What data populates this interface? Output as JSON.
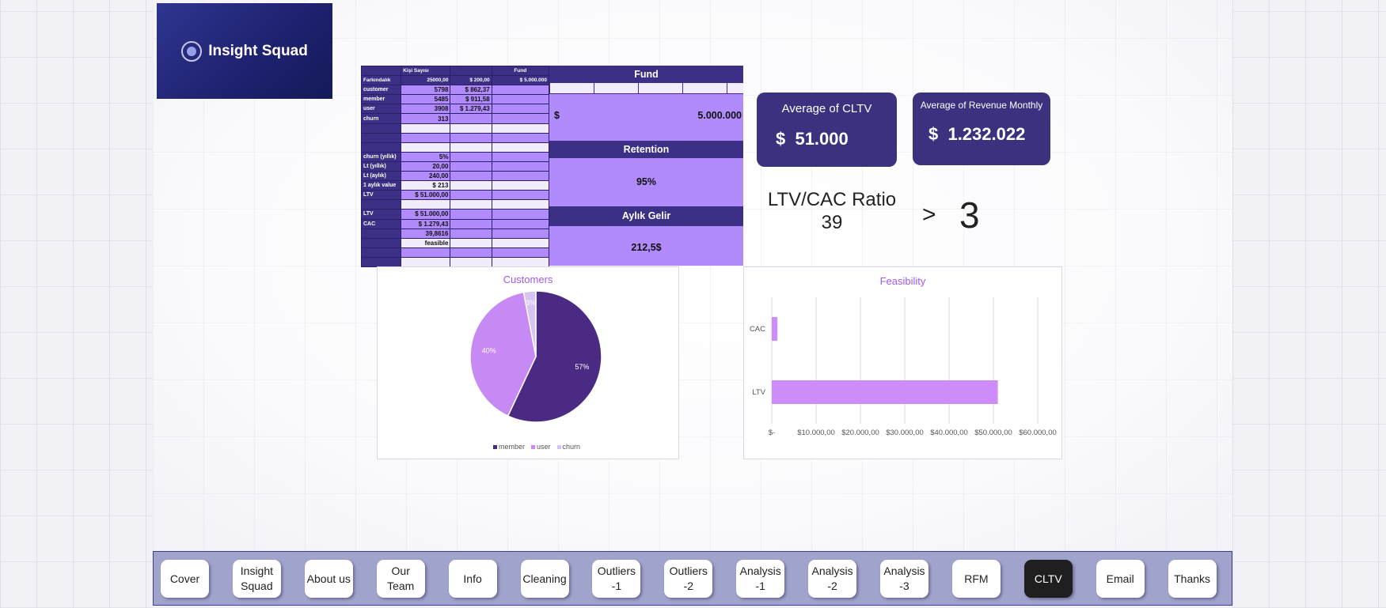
{
  "logo": {
    "text": "Insight Squad"
  },
  "sheet": {
    "header_row": [
      "",
      "Kişi Sayısı",
      "",
      "Fund"
    ],
    "row_farkindalik": [
      "Farkındalık",
      "25000,00",
      "$ 200,00",
      "$ 5.000.000"
    ],
    "rows": [
      {
        "label": "customer",
        "num": "5798",
        "v2": "$ 862,37",
        "v3": ""
      },
      {
        "label": "member",
        "num": "5485",
        "v2": "$ 911,58",
        "v3": ""
      },
      {
        "label": "user",
        "num": "3908",
        "v2": "$ 1.279,43",
        "v3": ""
      },
      {
        "label": "churn",
        "num": "313",
        "v2": "",
        "v3": ""
      },
      {
        "label": "",
        "num": "",
        "v2": "",
        "v3": ""
      },
      {
        "label": "",
        "num": "",
        "v2": "",
        "v3": ""
      },
      {
        "label": "",
        "num": "",
        "v2": "",
        "v3": ""
      },
      {
        "label": "churn (yıllık)",
        "num": "5%",
        "v2": "",
        "v3": ""
      },
      {
        "label": "Lt (yıllık)",
        "num": "20,00",
        "v2": "",
        "v3": ""
      },
      {
        "label": "Lt (aylık)",
        "num": "240,00",
        "v2": "",
        "v3": ""
      },
      {
        "label": "1 aylık value",
        "num": "$ 213",
        "v2": "",
        "v3": ""
      },
      {
        "label": "LTV",
        "num": "$ 51.000,00",
        "v2": "",
        "v3": ""
      },
      {
        "label": "",
        "num": "",
        "v2": "",
        "v3": ""
      },
      {
        "label": "LTV",
        "num": "$ 51.000,00",
        "v2": "",
        "v3": ""
      },
      {
        "label": "CAC",
        "num": "$ 1.279,43",
        "v2": "",
        "v3": ""
      },
      {
        "label": "",
        "num": "39,8616",
        "v2": "",
        "v3": ""
      },
      {
        "label": "",
        "num": "feasible",
        "v2": "",
        "v3": ""
      },
      {
        "label": "",
        "num": "",
        "v2": "",
        "v3": ""
      },
      {
        "label": "",
        "num": "",
        "v2": "",
        "v3": ""
      }
    ],
    "fund_title": "Fund",
    "fund_currency": "$",
    "fund_value": "5.000.000",
    "retention_title": "Retention",
    "retention_value": "95%",
    "income_title": "Aylık Gelir",
    "income_value": "212,5$"
  },
  "kpi": {
    "cltv_label": "Average of CLTV",
    "cltv_value": "$  51.000",
    "revenue_label": "Average of Revenue Monthly",
    "revenue_value": "$  1.232.022"
  },
  "ratio": {
    "label": "LTV/CAC Ratio",
    "value": "39",
    "operator": ">",
    "threshold": "3"
  },
  "colors": {
    "member": "#4a2a83",
    "user": "#c78af5",
    "churn": "#d6c4f2",
    "bar": "#cd8cf7",
    "navy": "#3b327f"
  },
  "chart_data": [
    {
      "type": "pie",
      "title": "Customers",
      "categories": [
        "member",
        "user",
        "churn"
      ],
      "values": [
        57,
        40,
        3
      ],
      "labels": [
        "57%",
        "40%",
        "3%"
      ],
      "legend": "bottom"
    },
    {
      "type": "bar",
      "orientation": "horizontal",
      "title": "Feasibility",
      "categories": [
        "LTV",
        "CAC"
      ],
      "values": [
        51000,
        1279.43
      ],
      "xlim": [
        0,
        60000
      ],
      "xticks": [
        "$-",
        "$10.000,00",
        "$20.000,00",
        "$30.000,00",
        "$40.000,00",
        "$50.000,00",
        "$60.000,00"
      ],
      "grid": true
    }
  ],
  "nav": {
    "items": [
      {
        "label": "Cover"
      },
      {
        "label": "Insight Squad"
      },
      {
        "label": "About us"
      },
      {
        "label": "Our Team"
      },
      {
        "label": "Info"
      },
      {
        "label": "Cleaning"
      },
      {
        "label": "Outliers -1"
      },
      {
        "label": "Outliers -2"
      },
      {
        "label": "Analysis -1"
      },
      {
        "label": "Analysis -2"
      },
      {
        "label": "Analysis -3"
      },
      {
        "label": "RFM"
      },
      {
        "label": "CLTV",
        "active": true
      },
      {
        "label": "Email"
      },
      {
        "label": "Thanks"
      }
    ]
  }
}
